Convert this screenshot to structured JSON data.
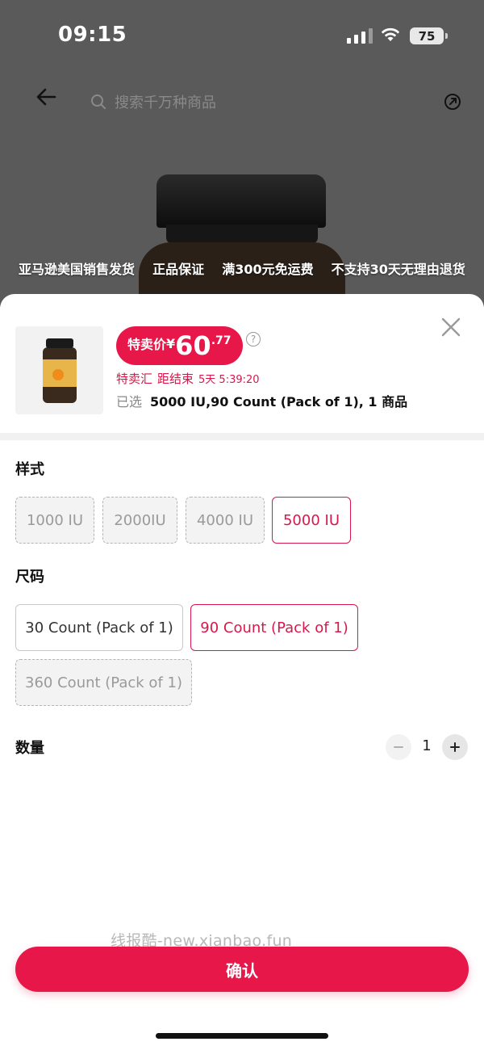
{
  "status_bar": {
    "time": "09:15",
    "battery": "75"
  },
  "nav": {
    "search_placeholder": "搜索千万种商品"
  },
  "promo_banners": [
    "亚马逊美国销售发货",
    "正品保证",
    "满300元免运费",
    "不支持30天无理由退货"
  ],
  "product": {
    "price_label": "特卖价",
    "currency": "¥",
    "price_int": "60",
    "price_dec": ".77",
    "deal_name": "特卖汇",
    "countdown_label": "距结束",
    "countdown": "5天 5:39:20",
    "selected_label": "已选",
    "selected_value": "5000 IU,90 Count (Pack of 1), 1 商品"
  },
  "style_section": {
    "title": "样式",
    "options": [
      {
        "label": "1000 IU",
        "state": "disabled"
      },
      {
        "label": "2000IU",
        "state": "disabled"
      },
      {
        "label": "4000 IU",
        "state": "disabled"
      },
      {
        "label": "5000 IU",
        "state": "selected"
      }
    ]
  },
  "size_section": {
    "title": "尺码",
    "options": [
      {
        "label": "30 Count (Pack of 1)",
        "state": "normal"
      },
      {
        "label": "90 Count (Pack of 1)",
        "state": "selected"
      },
      {
        "label": "360 Count (Pack of 1)",
        "state": "disabled"
      }
    ]
  },
  "quantity": {
    "title": "数量",
    "value": "1"
  },
  "watermark": "线报酷-new.xianbao.fun",
  "confirm_label": "确认",
  "colors": {
    "accent": "#e8174a",
    "disabled_bg": "#f3f3f3"
  }
}
